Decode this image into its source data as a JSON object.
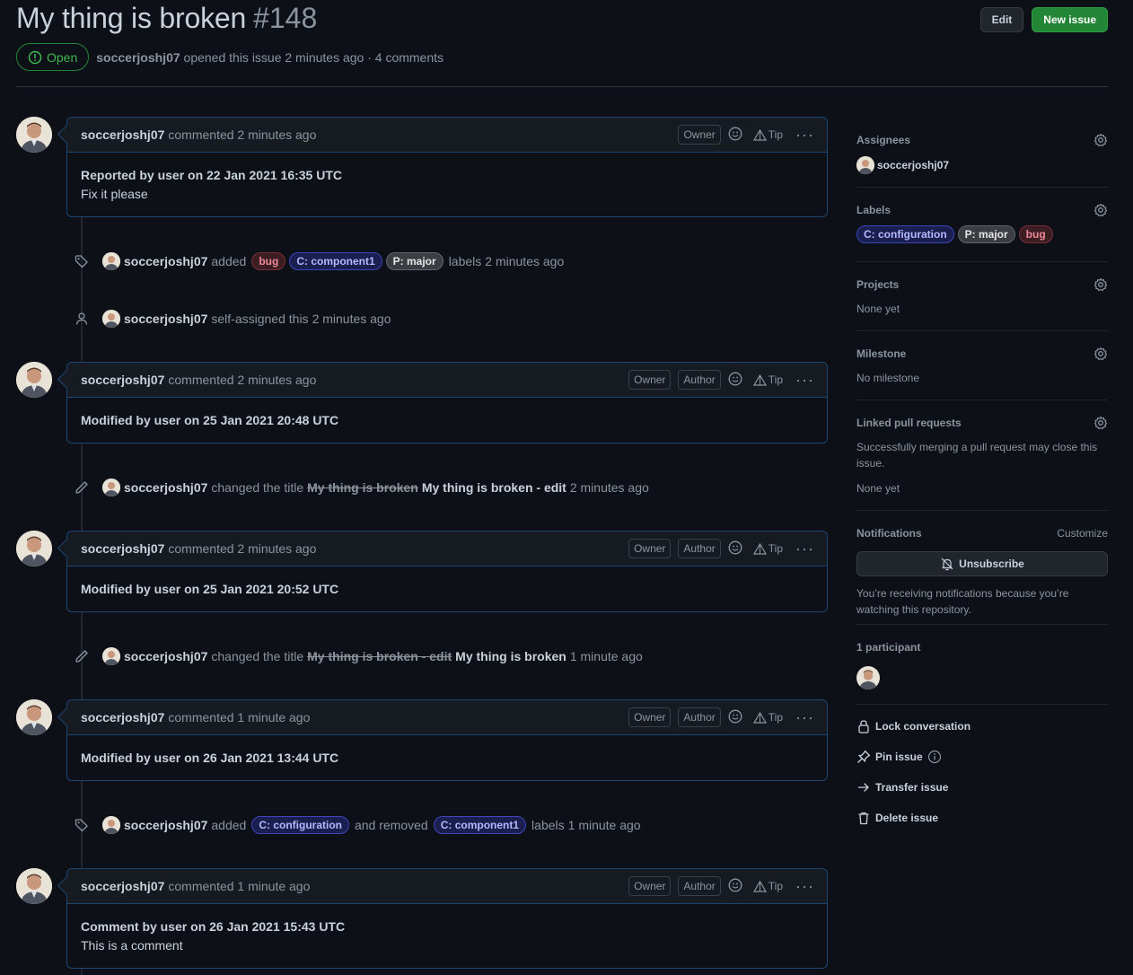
{
  "header": {
    "title": "My thing is broken",
    "number": "#148",
    "edit_label": "Edit",
    "new_issue_label": "New issue",
    "state": "Open",
    "author": "soccerjoshj07",
    "meta_suffix": "opened this issue 2 minutes ago · 4 comments"
  },
  "comments": [
    {
      "author": "soccerjoshj07",
      "when": "commented 2 minutes ago",
      "roles": [
        "Owner"
      ],
      "line1": "Reported by user on 22 Jan 2021 16:35 UTC",
      "line2": "Fix it please"
    },
    {
      "author": "soccerjoshj07",
      "when": "commented 2 minutes ago",
      "roles": [
        "Owner",
        "Author"
      ],
      "line1": "Modified by user on 25 Jan 2021 20:48 UTC",
      "line2": ""
    },
    {
      "author": "soccerjoshj07",
      "when": "commented 2 minutes ago",
      "roles": [
        "Owner",
        "Author"
      ],
      "line1": "Modified by user on 25 Jan 2021 20:52 UTC",
      "line2": ""
    },
    {
      "author": "soccerjoshj07",
      "when": "commented 1 minute ago",
      "roles": [
        "Owner",
        "Author"
      ],
      "line1": "Modified by user on 26 Jan 2021 13:44 UTC",
      "line2": ""
    },
    {
      "author": "soccerjoshj07",
      "when": "commented 1 minute ago",
      "roles": [
        "Owner",
        "Author"
      ],
      "line1": "Comment by user on 26 Jan 2021 15:43 UTC",
      "line2": "This is a comment"
    }
  ],
  "tip_label": "Tip",
  "events": {
    "e1": {
      "author": "soccerjoshj07",
      "added": "added",
      "labels": [
        "bug",
        "C: component1",
        "P: major"
      ],
      "suffix": "labels",
      "when": "2 minutes ago"
    },
    "e2": {
      "author": "soccerjoshj07",
      "text": "self-assigned this",
      "when": "2 minutes ago"
    },
    "e3": {
      "author": "soccerjoshj07",
      "text": "changed the title",
      "old": "My thing is broken",
      "new": "My thing is broken - edit",
      "when": "2 minutes ago"
    },
    "e4": {
      "author": "soccerjoshj07",
      "text": "changed the title",
      "old": "My thing is broken - edit",
      "new": "My thing is broken",
      "when": "1 minute ago"
    },
    "e5": {
      "author": "soccerjoshj07",
      "added": "added",
      "label_added": "C: configuration",
      "removed": "and removed",
      "label_removed": "C: component1",
      "suffix": "labels",
      "when": "1 minute ago"
    }
  },
  "sidebar": {
    "assignees": {
      "title": "Assignees",
      "user": "soccerjoshj07"
    },
    "labels": {
      "title": "Labels",
      "items": [
        "C: configuration",
        "P: major",
        "bug"
      ]
    },
    "projects": {
      "title": "Projects",
      "value": "None yet"
    },
    "milestone": {
      "title": "Milestone",
      "value": "No milestone"
    },
    "linked": {
      "title": "Linked pull requests",
      "desc": "Successfully merging a pull request may close this issue.",
      "value": "None yet"
    },
    "notifications": {
      "title": "Notifications",
      "customize": "Customize",
      "button": "Unsubscribe",
      "desc": "You’re receiving notifications because you’re watching this repository."
    },
    "participants": {
      "title": "1 participant"
    },
    "actions": {
      "lock": "Lock conversation",
      "pin": "Pin issue",
      "transfer": "Transfer issue",
      "delete": "Delete issue"
    }
  },
  "colors": {
    "bg": "#0d1117",
    "open_green": "#3fb950",
    "comment_border": "#1f4574",
    "btn_green": "#238636"
  }
}
